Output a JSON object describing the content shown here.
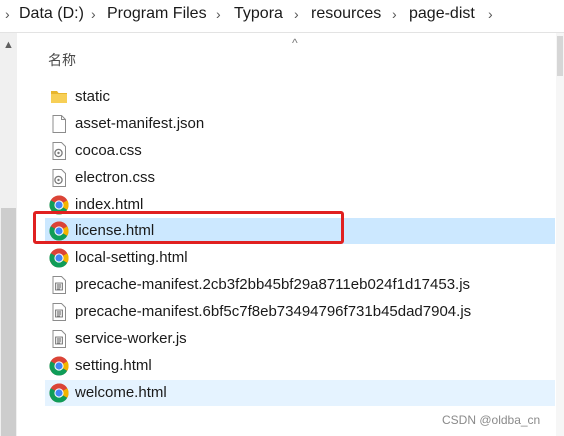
{
  "breadcrumb": {
    "segments": [
      "Data (D:)",
      "Program Files",
      "Typora",
      "resources",
      "page-dist"
    ],
    "separator": "›"
  },
  "file_list": {
    "column_header": "名称",
    "selected_item": "license.html",
    "hovered_item": "welcome.html",
    "items": [
      {
        "name": "static",
        "icon": "folder-icon"
      },
      {
        "name": "asset-manifest.json",
        "icon": "file-icon"
      },
      {
        "name": "cocoa.css",
        "icon": "css-file-icon"
      },
      {
        "name": "electron.css",
        "icon": "css-file-icon"
      },
      {
        "name": "index.html",
        "icon": "chrome-icon"
      },
      {
        "name": "license.html",
        "icon": "chrome-icon"
      },
      {
        "name": "local-setting.html",
        "icon": "chrome-icon"
      },
      {
        "name": "precache-manifest.2cb3f2bb45bf29a8711eb024f1d17453.js",
        "icon": "js-file-icon"
      },
      {
        "name": "precache-manifest.6bf5c7f8eb73494796f731b45dad7904.js",
        "icon": "js-file-icon"
      },
      {
        "name": "service-worker.js",
        "icon": "js-file-icon"
      },
      {
        "name": "setting.html",
        "icon": "chrome-icon"
      },
      {
        "name": "welcome.html",
        "icon": "chrome-icon"
      }
    ]
  },
  "colors": {
    "selection": "#cce8ff",
    "hover": "#e5f3ff",
    "highlight_border": "#e02020"
  },
  "watermark": "CSDN @oldba_cn"
}
